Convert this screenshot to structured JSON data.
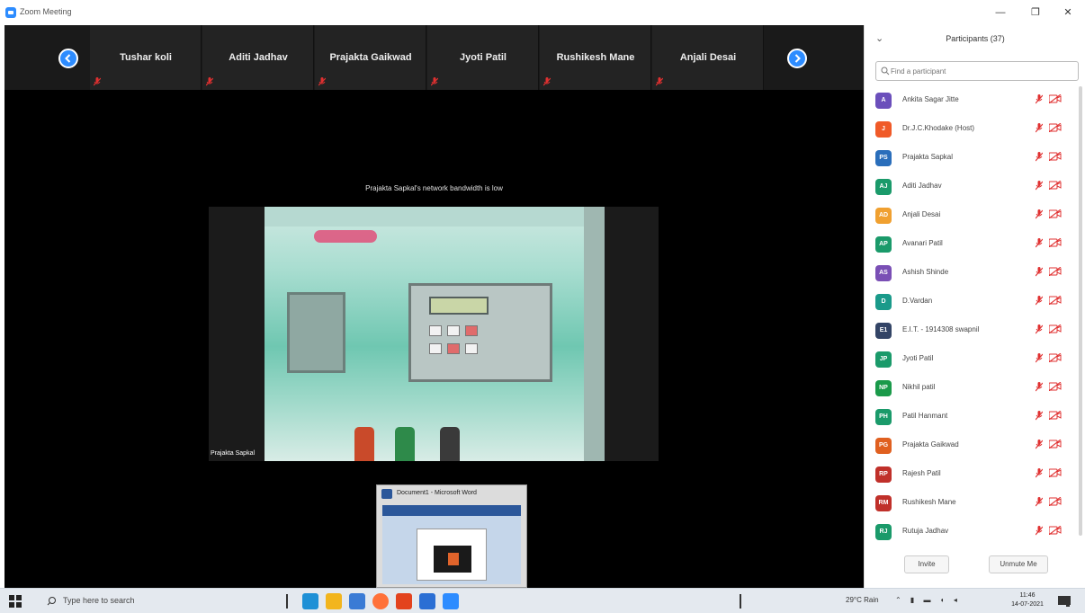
{
  "window": {
    "title": "Zoom Meeting",
    "minimize_glyph": "—",
    "restore_glyph": "❐",
    "close_glyph": "✕"
  },
  "filmstrip": {
    "tiles": [
      {
        "name": "Tushar koli"
      },
      {
        "name": "Aditi Jadhav"
      },
      {
        "name": "Prajakta Gaikwad"
      },
      {
        "name": "Jyoti Patil"
      },
      {
        "name": "Rushikesh Mane"
      },
      {
        "name": "Anjali Desai"
      }
    ]
  },
  "main": {
    "bandwidth_notice": "Prajakta Sapkal's network bandwidth is low",
    "active_speaker_name": "Prajakta Sapkal"
  },
  "popup": {
    "title": "Document1 - Microsoft Word"
  },
  "participants": {
    "collapse_glyph": "⌄",
    "title": "Participants (37)",
    "search_placeholder": "Find a participant",
    "list": [
      {
        "initials": "A",
        "name": "Ankita Sagar Jitte",
        "color": "#6b4fbb"
      },
      {
        "initials": "J",
        "name": "Dr.J.C.Khodake (Host)",
        "color": "#f05a28"
      },
      {
        "initials": "PS",
        "name": "Prajakta Sapkal",
        "color": "#2a6ebb"
      },
      {
        "initials": "AJ",
        "name": "Aditi Jadhav",
        "color": "#1a9a6a"
      },
      {
        "initials": "AD",
        "name": "Anjali Desai",
        "color": "#f0a030"
      },
      {
        "initials": "AP",
        "name": "Avanari Patil",
        "color": "#1a9a6a"
      },
      {
        "initials": "AS",
        "name": "Ashish Shinde",
        "color": "#7a4fb5"
      },
      {
        "initials": "D",
        "name": "D.Vardan",
        "color": "#1a9a8a"
      },
      {
        "initials": "E1",
        "name": "E.I.T. - 1914308 swapnil",
        "color": "#334466"
      },
      {
        "initials": "JP",
        "name": "Jyoti Patil",
        "color": "#1a9a6a"
      },
      {
        "initials": "NP",
        "name": "Nikhil patil",
        "color": "#1a9a4a"
      },
      {
        "initials": "PH",
        "name": "Patil Hanmant",
        "color": "#1a9a6a"
      },
      {
        "initials": "PG",
        "name": "Prajakta Gaikwad",
        "color": "#e06020"
      },
      {
        "initials": "RP",
        "name": "Rajesh Patil",
        "color": "#c0302a"
      },
      {
        "initials": "RM",
        "name": "Rushikesh Mane",
        "color": "#c0302a"
      },
      {
        "initials": "RJ",
        "name": "Rutuja Jadhav",
        "color": "#1a9a6a"
      }
    ],
    "invite_label": "Invite",
    "unmute_label": "Unmute Me"
  },
  "taskbar": {
    "search_placeholder": "Type here to search",
    "weather": "29°C Rain",
    "time": "11:46",
    "date": "14-07-2021"
  }
}
